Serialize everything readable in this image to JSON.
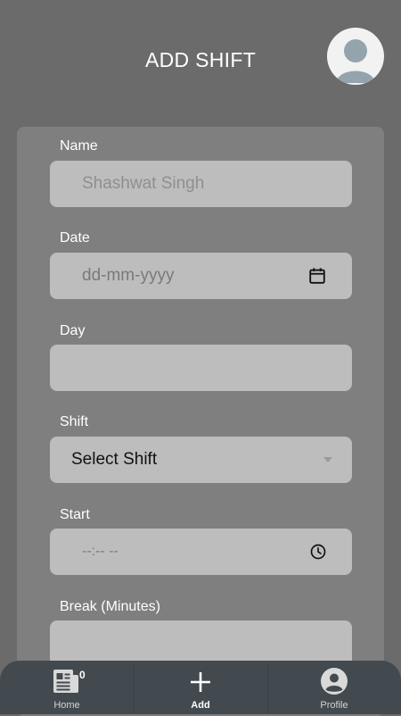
{
  "header": {
    "title": "ADD SHIFT"
  },
  "form": {
    "name": {
      "label": "Name",
      "placeholder": "Shashwat Singh"
    },
    "date": {
      "label": "Date",
      "placeholder": "dd-mm-yyyy"
    },
    "day": {
      "label": "Day",
      "value": ""
    },
    "shift": {
      "label": "Shift",
      "selected": "Select Shift"
    },
    "start": {
      "label": "Start",
      "placeholder": "--:-- --"
    },
    "break": {
      "label": "Break (Minutes)",
      "value": ""
    }
  },
  "nav": {
    "home": {
      "label": "Home",
      "badge": "0",
      "icon": "newspaper-icon"
    },
    "add": {
      "label": "Add",
      "icon": "plus-icon"
    },
    "profile": {
      "label": "Profile",
      "icon": "account-circle-icon"
    }
  },
  "colors": {
    "background": "#6b6b6b",
    "card": "#7f7f7f",
    "field": "#bdbdbd",
    "nav": "#424a4f"
  }
}
